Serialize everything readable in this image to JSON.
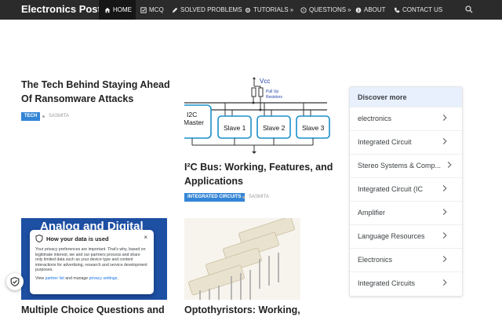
{
  "nav": {
    "brand": "Electronics Post",
    "items": [
      {
        "label": "HOME",
        "icon": "home-icon"
      },
      {
        "label": "MCQ",
        "icon": "checkbox-icon"
      },
      {
        "label": "SOLVED PROBLEMS",
        "icon": "pencil-icon"
      },
      {
        "label": "TUTORIALS",
        "icon": "gears-icon"
      },
      {
        "label": "QUESTIONS",
        "icon": "question-icon"
      },
      {
        "label": "ABOUT",
        "icon": "info-icon"
      },
      {
        "label": "CONTACT US",
        "icon": "phone-icon"
      }
    ],
    "search_icon": "search-icon"
  },
  "posts": [
    {
      "title": "The Tech Behind Staying Ahead Of Ransomware Attacks",
      "category": "TECH",
      "author": "SASMITA"
    },
    {
      "title": "I²C Bus: Working, Features, and Applications",
      "category": "INTEGRATED CIRCUITS",
      "author": "SASMITA"
    },
    {
      "title": "Multiple Choice Questions and",
      "category": "",
      "author": ""
    },
    {
      "title": "Optothyristors: Working,",
      "category": "",
      "author": ""
    }
  ],
  "diagram": {
    "vcc": "Vcc",
    "pullup": "Pull Up",
    "resistors": "Resistors",
    "master": [
      "I2C",
      "Master"
    ],
    "slaves": [
      "Slave 1",
      "Slave 2",
      "Slave 3"
    ]
  },
  "analog_banner": "Analog and Digital",
  "sidebar": {
    "title": "Discover more",
    "items": [
      {
        "label": "electronics"
      },
      {
        "label": "Integrated Circuit"
      },
      {
        "label": "Stereo Systems & Comp..."
      },
      {
        "label": "Integrated Circuit (IC"
      },
      {
        "label": "Amplifier"
      },
      {
        "label": "Language Resources"
      },
      {
        "label": "Electronics"
      },
      {
        "label": "Integrated Circuits"
      }
    ]
  },
  "privacy": {
    "title": "How your data is used",
    "body": "Your privacy preferences are important. That's why, based on legitimate interest, we and our partners process and share only limited data such as your device type and content interactions for advertising, research and service development purposes.",
    "footer_prefix": "View",
    "partner_link": "partner list",
    "footer_middle": "and manage",
    "settings_link": "privacy settings",
    "close": "×"
  },
  "colors": {
    "nav_bg": "#2b2b2b",
    "tag_bg": "#3385d6",
    "sidebar_head": "#e8f0fe",
    "banner_bg": "#1d4fa3"
  }
}
